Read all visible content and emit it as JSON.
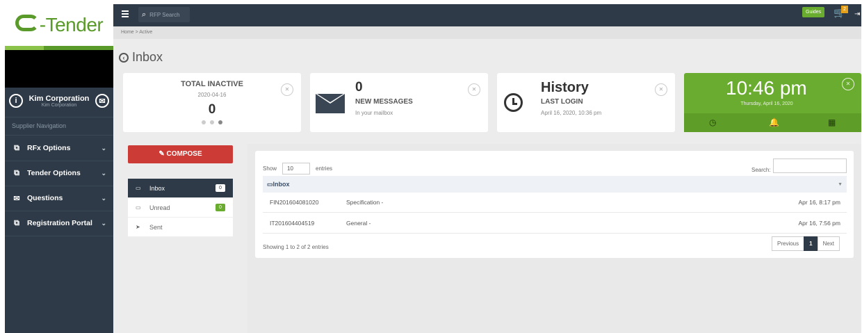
{
  "brand": {
    "logo_text": "-Tender"
  },
  "user": {
    "name": "Kim Corporation",
    "sub": "Kim Corporation"
  },
  "sidebar": {
    "title": "Supplier Navigation",
    "items": [
      {
        "label": "RFx Options",
        "icon": "copy-icon"
      },
      {
        "label": "Tender Options",
        "icon": "copy-icon"
      },
      {
        "label": "Questions",
        "icon": "envelope-icon"
      },
      {
        "label": "Registration Portal",
        "icon": "copy-icon"
      }
    ]
  },
  "topbar": {
    "search_placeholder": "RFP Search",
    "guides_label": "Guides",
    "cart_count": "2"
  },
  "breadcrumb": "Home  >  Active",
  "page": {
    "title": "Inbox"
  },
  "cards": {
    "inactive": {
      "title": "TOTAL INACTIVE",
      "date": "2020-04-16",
      "value": "0"
    },
    "messages": {
      "value": "0",
      "title": "NEW MESSAGES",
      "sub": "In your mailbox"
    },
    "history": {
      "title": "History",
      "label": "LAST LOGIN",
      "sub": "April 16, 2020, 10:36 pm"
    },
    "clock": {
      "time": "10:46 pm",
      "date": "Thursday, April 16, 2020"
    }
  },
  "compose": {
    "label": "COMPOSE"
  },
  "folders": [
    {
      "label": "Inbox",
      "badge": "0"
    },
    {
      "label": "Unread",
      "badge": "0"
    },
    {
      "label": "Sent",
      "badge": ""
    }
  ],
  "table": {
    "show_label": "Show",
    "show_value": "10",
    "entries_label": "entries",
    "search_label": "Search:",
    "header": "Inbox",
    "rows": [
      {
        "id": "FIN201604081020",
        "subject": "Specification -",
        "date": "Apr 16, 8:17 pm"
      },
      {
        "id": "IT201604404519",
        "subject": "General -",
        "date": "Apr 16, 7:56 pm"
      }
    ],
    "info": "Showing 1 to 2 of 2 entries",
    "pager": {
      "prev": "Previous",
      "current": "1",
      "next": "Next"
    }
  },
  "colors": {
    "sidebar": "#2e3a47",
    "accent_green": "#6aac2f",
    "compose_red": "#cc3b35"
  }
}
